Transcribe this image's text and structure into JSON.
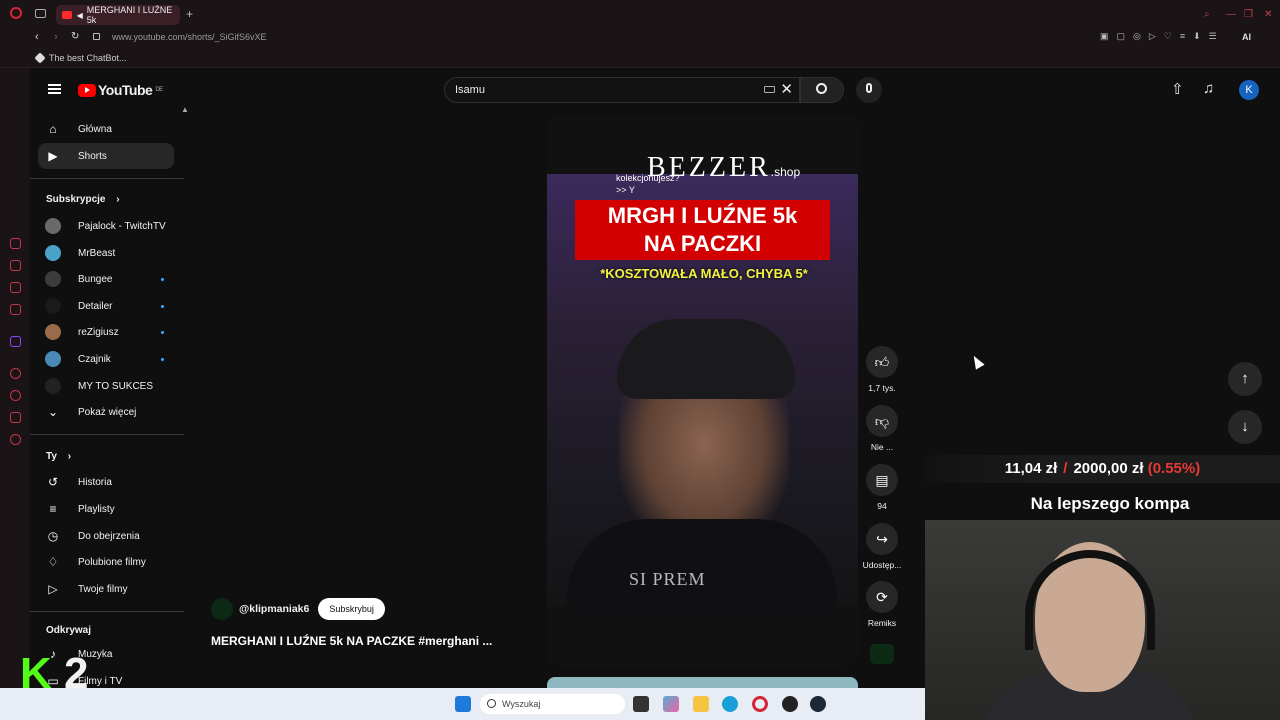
{
  "browser": {
    "tab_title": "MERGHANI I LUŹNE 5k",
    "new_tab": "+",
    "url": "www.youtube.com/shorts/_SiGifS6vXE",
    "bookmark": "The best ChatBot...",
    "ai_label": "AI"
  },
  "header": {
    "logo": "YouTube",
    "country": "DE",
    "search_value": "Isamu",
    "avatar_letter": "K"
  },
  "nav": {
    "main": [
      {
        "label": "Główna",
        "icon": "home-icon"
      },
      {
        "label": "Shorts",
        "icon": "shorts-icon"
      }
    ],
    "subs_title": "Subskrypcje",
    "subs": [
      {
        "label": "Pajalock - TwitchTV",
        "color": "#6a6a6a",
        "dot": false
      },
      {
        "label": "MrBeast",
        "color": "#4aa3c8",
        "dot": false
      },
      {
        "label": "Bungee",
        "color": "#3c3c3c",
        "dot": true
      },
      {
        "label": "Detailer",
        "color": "#1a1a1a",
        "dot": true
      },
      {
        "label": "reZigiusz",
        "color": "#9a6a4a",
        "dot": true
      },
      {
        "label": "Czajnik",
        "color": "#4a8ab8",
        "dot": true
      },
      {
        "label": "MY TO SUKCES",
        "color": "#222222",
        "dot": false
      }
    ],
    "show_more": "Pokaż więcej",
    "you_title": "Ty",
    "you": [
      {
        "label": "Historia",
        "icon": "history-icon"
      },
      {
        "label": "Playlisty",
        "icon": "playlist-icon"
      },
      {
        "label": "Do obejrzenia",
        "icon": "clock-icon"
      },
      {
        "label": "Polubione filmy",
        "icon": "like-icon"
      },
      {
        "label": "Twoje filmy",
        "icon": "video-icon"
      }
    ],
    "explore_title": "Odkrywaj",
    "explore": [
      {
        "label": "Muzyka"
      },
      {
        "label": "Filmy i TV"
      }
    ]
  },
  "video": {
    "brand": "BEZZER",
    "brand_suffix": ".shop",
    "ask_line1": "kolekcjonujesz?",
    "ask_line2": ">> Y",
    "caption_line1": "MRGH I LUŹNE 5k",
    "caption_line2": "NA PACZKI",
    "caption_yellow": "*KOSZTOWAŁA MAŁO, CHYBA 5*",
    "shirt_text": "SI PREM",
    "channel": "@klipmaniak6",
    "subscribe": "Subskrybuj",
    "title": "MERGHANI I LUŹNE 5k NA PACZKE #merghani ..."
  },
  "actions": {
    "likes": "1,7 tys.",
    "dislike": "Nie ...",
    "comments": "94",
    "share": "Udostęp...",
    "remix": "Remiks"
  },
  "stream": {
    "goal_current": "11,04 zł",
    "goal_sep": "/",
    "goal_target": "2000,00 zł",
    "goal_percent": "(0.55%)",
    "goal_name": "Na lepszego kompa",
    "kick_label": "2"
  },
  "taskbar": {
    "search": "Wyszukaj"
  }
}
